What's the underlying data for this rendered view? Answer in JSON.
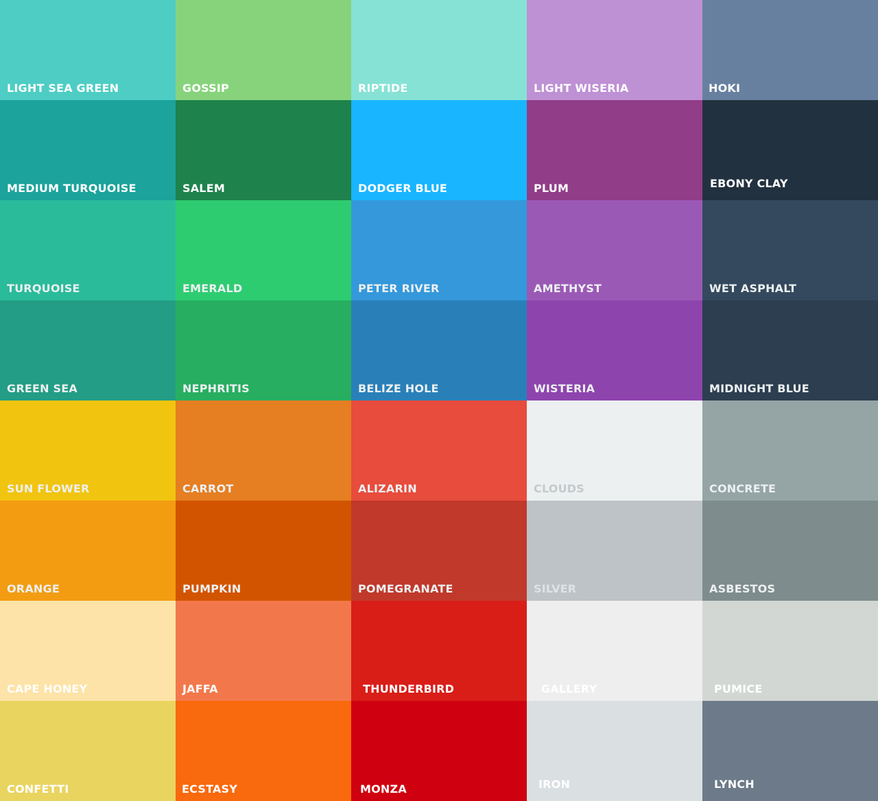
{
  "palette": {
    "columns": 5,
    "swatches": [
      {
        "name": "LIGHT SEA GREEN",
        "color": "#4ecdc4",
        "text_color": "#ffffff"
      },
      {
        "name": "GOSSIP",
        "color": "#87d37c",
        "text_color": "#ffffff"
      },
      {
        "name": "RIPTIDE",
        "color": "#86e2d5",
        "text_color": "#ffffff"
      },
      {
        "name": "LIGHT WISERIA",
        "color": "#be90d4",
        "text_color": "#ffffff"
      },
      {
        "name": "HOKI",
        "color": "#67809f",
        "text_color": "#ffffff"
      },
      {
        "name": "MEDIUM TURQUOISE",
        "color": "#1ba39c",
        "text_color": "#ffffff"
      },
      {
        "name": "SALEM",
        "color": "#1e824c",
        "text_color": "#ffffff"
      },
      {
        "name": "DODGER BLUE",
        "color": "#19b5fe",
        "text_color": "#ffffff"
      },
      {
        "name": "PLUM",
        "color": "#913d88",
        "text_color": "#ffffff"
      },
      {
        "name": "EBONY CLAY",
        "color": "#22313f",
        "text_color": "#ffffff"
      },
      {
        "name": "TURQUOISE",
        "color": "#2abb9b",
        "text_color": "#ecf0f1"
      },
      {
        "name": "EMERALD",
        "color": "#2ecc71",
        "text_color": "#ecf0f1"
      },
      {
        "name": "PETER RIVER",
        "color": "#3498db",
        "text_color": "#ecf0f1"
      },
      {
        "name": "AMETHYST",
        "color": "#9b59b6",
        "text_color": "#ecf0f1"
      },
      {
        "name": "WET ASPHALT",
        "color": "#34495e",
        "text_color": "#ecf0f1"
      },
      {
        "name": "GREEN SEA",
        "color": "#239d85",
        "text_color": "#ecf0f1"
      },
      {
        "name": "NEPHRITIS",
        "color": "#27ae60",
        "text_color": "#ecf0f1"
      },
      {
        "name": "BELIZE HOLE",
        "color": "#2980b9",
        "text_color": "#ecf0f1"
      },
      {
        "name": "WISTERIA",
        "color": "#8e44ad",
        "text_color": "#ecf0f1"
      },
      {
        "name": "MIDNIGHT BLUE",
        "color": "#2c3e50",
        "text_color": "#ecf0f1"
      },
      {
        "name": "SUN FLOWER",
        "color": "#f1c40f",
        "text_color": "#ecf0f1"
      },
      {
        "name": "CARROT",
        "color": "#e67e22",
        "text_color": "#ecf0f1"
      },
      {
        "name": "ALIZARIN",
        "color": "#e74c3c",
        "text_color": "#ecf0f1"
      },
      {
        "name": "CLOUDS",
        "color": "#ecf0f1",
        "text_color": "#c4c9cc"
      },
      {
        "name": "CONCRETE",
        "color": "#95a5a6",
        "text_color": "#ecf0f1"
      },
      {
        "name": "ORANGE",
        "color": "#f39c12",
        "text_color": "#ecf0f1"
      },
      {
        "name": "PUMPKIN",
        "color": "#d35400",
        "text_color": "#ecf0f1"
      },
      {
        "name": "POMEGRANATE",
        "color": "#c0392b",
        "text_color": "#ecf0f1"
      },
      {
        "name": "SILVER",
        "color": "#bdc3c7",
        "text_color": "#dfe3e6"
      },
      {
        "name": "ASBESTOS",
        "color": "#7f8c8d",
        "text_color": "#ecf0f1"
      },
      {
        "name": "CAPE HONEY",
        "color": "#fde3a7",
        "text_color": "#ffffff"
      },
      {
        "name": "JAFFA",
        "color": "#f2784b",
        "text_color": "#ffffff"
      },
      {
        "name": "THUNDERBIRD",
        "color": "#d91e18",
        "text_color": "#ffffff"
      },
      {
        "name": "GALLERY",
        "color": "#eeeeee",
        "text_color": "#ffffff"
      },
      {
        "name": "PUMICE",
        "color": "#d2d7d3",
        "text_color": "#ffffff"
      },
      {
        "name": "CONFETTI",
        "color": "#e9d460",
        "text_color": "#ffffff"
      },
      {
        "name": "ECSTASY",
        "color": "#f9690e",
        "text_color": "#ffffff"
      },
      {
        "name": "MONZA",
        "color": "#cf000f",
        "text_color": "#ffffff"
      },
      {
        "name": "IRON",
        "color": "#dadfe1",
        "text_color": "#ffffff"
      },
      {
        "name": "LYNCH",
        "color": "#6c7a89",
        "text_color": "#ffffff"
      }
    ]
  }
}
